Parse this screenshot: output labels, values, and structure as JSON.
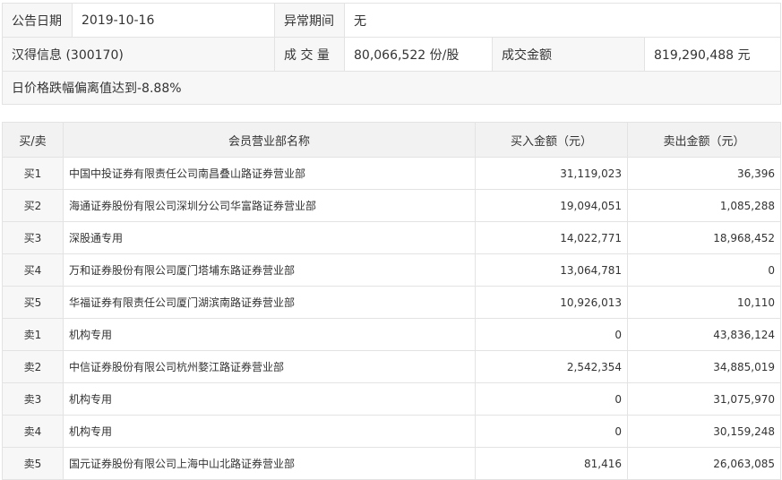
{
  "info": {
    "announce_date_label": "公告日期",
    "announce_date": "2019-10-16",
    "abnormal_period_label": "异常期间",
    "abnormal_period": "无",
    "stock_name": "汉得信息 (300170)",
    "volume_label": "成 交 量",
    "volume": "80,066,522 份/股",
    "turnover_label": "成交金额",
    "turnover": "819,290,488 元",
    "reason": "日价格跌幅偏离值达到-8.88%"
  },
  "trade_table": {
    "headers": {
      "side": "买/卖",
      "dept": "会员营业部名称",
      "buy": "买入金额（元）",
      "sell": "卖出金额（元）"
    },
    "rows": [
      {
        "side": "买1",
        "dept": "中国中投证券有限责任公司南昌叠山路证券营业部",
        "buy": "31,119,023",
        "sell": "36,396"
      },
      {
        "side": "买2",
        "dept": "海通证券股份有限公司深圳分公司华富路证券营业部",
        "buy": "19,094,051",
        "sell": "1,085,288"
      },
      {
        "side": "买3",
        "dept": "深股通专用",
        "buy": "14,022,771",
        "sell": "18,968,452"
      },
      {
        "side": "买4",
        "dept": "万和证券股份有限公司厦门塔埔东路证券营业部",
        "buy": "13,064,781",
        "sell": "0"
      },
      {
        "side": "买5",
        "dept": "华福证券有限责任公司厦门湖滨南路证券营业部",
        "buy": "10,926,013",
        "sell": "10,110"
      },
      {
        "side": "卖1",
        "dept": "机构专用",
        "buy": "0",
        "sell": "43,836,124"
      },
      {
        "side": "卖2",
        "dept": "中信证券股份有限公司杭州婺江路证券营业部",
        "buy": "2,542,354",
        "sell": "34,885,019"
      },
      {
        "side": "卖3",
        "dept": "机构专用",
        "buy": "0",
        "sell": "31,075,970"
      },
      {
        "side": "卖4",
        "dept": "机构专用",
        "buy": "0",
        "sell": "30,159,248"
      },
      {
        "side": "卖5",
        "dept": "国元证券股份有限公司上海中山北路证券营业部",
        "buy": "81,416",
        "sell": "26,063,085"
      }
    ]
  }
}
